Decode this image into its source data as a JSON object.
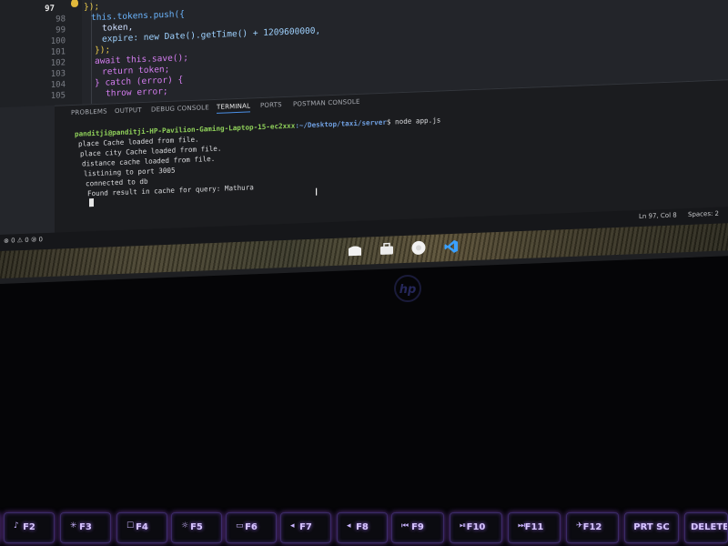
{
  "editor": {
    "lines": [
      {
        "num": "97",
        "active": true,
        "text": "});"
      },
      {
        "num": "98",
        "active": false,
        "text": "this.tokens.push({"
      },
      {
        "num": "99",
        "active": false,
        "text": "token,"
      },
      {
        "num": "100",
        "active": false,
        "text": "expire: new Date().getTime() + 1209600000,"
      },
      {
        "num": "101",
        "active": false,
        "text": "});"
      },
      {
        "num": "102",
        "active": false,
        "text": "await this.save();"
      },
      {
        "num": "103",
        "active": false,
        "text": "return token;"
      },
      {
        "num": "104",
        "active": false,
        "text": "} catch (error) {"
      },
      {
        "num": "105",
        "active": false,
        "text": "throw error;"
      }
    ]
  },
  "panel": {
    "tabs": [
      "PROBLEMS",
      "OUTPUT",
      "DEBUG CONSOLE",
      "TERMINAL",
      "PORTS",
      "POSTMAN CONSOLE"
    ],
    "active_tab": "TERMINAL"
  },
  "terminal": {
    "prompt_user": "panditji@panditji-HP-Pavilion-Gaming-Laptop-15-ec2xxx",
    "prompt_path": ":~/Desktop/taxi/server",
    "command": "$ node app.js",
    "output": [
      "place Cache loaded from file.",
      "place city Cache loaded from file.",
      "distance cache loaded from file.",
      "listining to port 3005",
      "connected to db",
      "Found result in cache for query: Mathura"
    ]
  },
  "statusbar": {
    "left": "⊗ 0 ⚠ 0   ⑩ 0",
    "position": "Ln 97, Col 8",
    "spaces": "Spaces: 2"
  },
  "dock": {
    "icons": [
      "files-icon",
      "briefcase-icon",
      "chrome-icon",
      "vscode-icon"
    ],
    "colors": {
      "chrome": "#f2f2f2",
      "vscode": "#3aa0ff"
    }
  },
  "laptop": {
    "logo": "hp",
    "fkeys": [
      {
        "label": "F2",
        "glyph": "♪"
      },
      {
        "label": "F3",
        "glyph": "✳"
      },
      {
        "label": "F4",
        "glyph": "☐"
      },
      {
        "label": "F5",
        "glyph": "☼"
      },
      {
        "label": "F6",
        "glyph": "▭"
      },
      {
        "label": "F7",
        "glyph": "◂"
      },
      {
        "label": "F8",
        "glyph": "◂"
      },
      {
        "label": "F9",
        "glyph": "⏮"
      },
      {
        "label": "F10",
        "glyph": "⏯"
      },
      {
        "label": "F11",
        "glyph": "⏭"
      },
      {
        "label": "F12",
        "glyph": "✈"
      },
      {
        "label": "PRT SC",
        "glyph": ""
      },
      {
        "label": "DELETE",
        "glyph": ""
      }
    ],
    "key_glow": "#a070ff"
  }
}
